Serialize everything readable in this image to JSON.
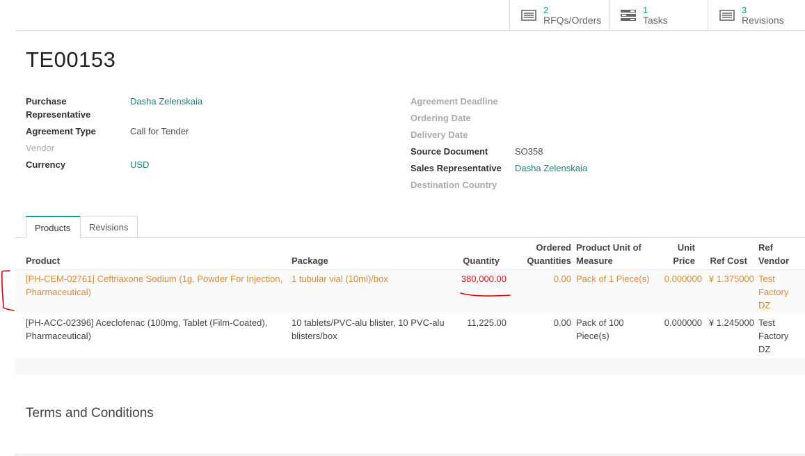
{
  "smart_buttons": [
    {
      "count": "2",
      "label": "RFQs/Orders",
      "icon": "list-icon"
    },
    {
      "count": "1",
      "label": "Tasks",
      "icon": "tasks-icon"
    },
    {
      "count": "3",
      "label": "Revisions",
      "icon": "list-icon"
    }
  ],
  "title": "TE00153",
  "left_fields": {
    "purchase_rep_label_1": "Purchase",
    "purchase_rep_label_2": "Representative",
    "purchase_rep_value": "Dasha Zelenskaia",
    "agreement_type_label": "Agreement Type",
    "agreement_type_value": "Call for Tender",
    "vendor_label": "Vendor",
    "currency_label": "Currency",
    "currency_value": "USD"
  },
  "right_fields": {
    "agreement_deadline_label": "Agreement Deadline",
    "ordering_date_label": "Ordering Date",
    "delivery_date_label": "Delivery Date",
    "source_document_label": "Source Document",
    "source_document_value": "SO358",
    "sales_rep_label": "Sales Representative",
    "sales_rep_value": "Dasha Zelenskaia",
    "destination_country_label": "Destination Country"
  },
  "tabs": [
    {
      "label": "Products",
      "active": true
    },
    {
      "label": "Revisions",
      "active": false
    }
  ],
  "table": {
    "headers": {
      "product": "Product",
      "package": "Package",
      "quantity": "Quantity",
      "ordered_1": "Ordered",
      "ordered_2": "Quantities",
      "uom_1": "Product Unit of",
      "uom_2": "Measure",
      "unit_price_1": "Unit",
      "unit_price_2": "Price",
      "ref_cost": "Ref Cost",
      "ref_vendor_1": "Ref",
      "ref_vendor_2": "Vendor"
    },
    "rows": [
      {
        "product_1": "[PH-CEM-02761] Ceftriaxone Sodium (1g, Powder For Injection,",
        "product_2": "Pharmaceutical)",
        "package_1": "1 tubular vial (10ml)/box",
        "package_2": "",
        "quantity": "380,000.00",
        "ordered": "0.00",
        "uom_1": "Pack of 1 Piece(s)",
        "uom_2": "",
        "unit_price": "0.000000",
        "ref_cost": "¥ 1.375000",
        "vendor_1": "Test",
        "vendor_2": "Factory",
        "vendor_3": "DZ"
      },
      {
        "product_1": "[PH-ACC-02396] Aceclofenac (100mg, Tablet (Film-Coated),",
        "product_2": "Pharmaceutical)",
        "package_1": "10 tablets/PVC-alu blister, 10 PVC-alu",
        "package_2": "blisters/box",
        "quantity": "11,225.00",
        "ordered": "0.00",
        "uom_1": "Pack of 100",
        "uom_2": "Piece(s)",
        "unit_price": "0.000000",
        "ref_cost": "¥ 1.245000",
        "vendor_1": "Test",
        "vendor_2": "Factory",
        "vendor_3": "DZ"
      }
    ]
  },
  "terms_title": "Terms and Conditions",
  "colors": {
    "accent": "#00a09d",
    "link": "#1a7f7a",
    "warning_row": "#d58a3b",
    "annotation": "#e00000"
  }
}
